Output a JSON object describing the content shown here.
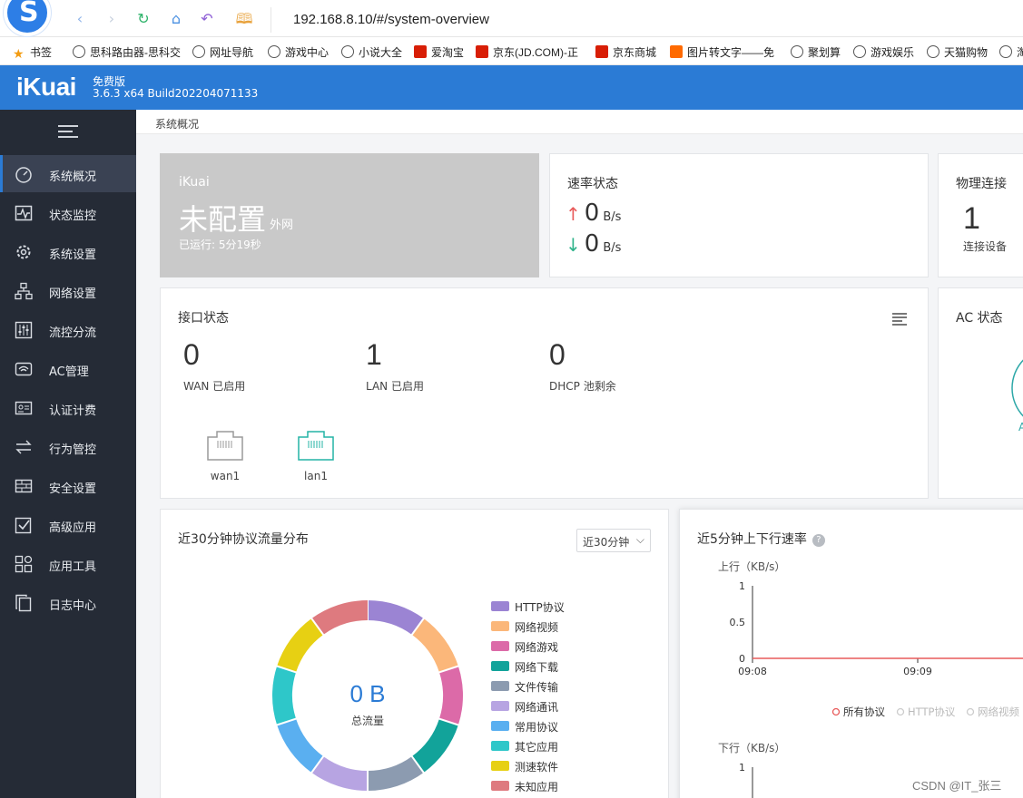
{
  "browser": {
    "url": "192.168.8.10/#/system-overview",
    "bookmarks": [
      {
        "label": "书签",
        "icon": "star-icon"
      },
      {
        "label": "思科路由器-思科交",
        "icon": "globe-icon"
      },
      {
        "label": "网址导航",
        "icon": "globe-icon"
      },
      {
        "label": "游戏中心",
        "icon": "globe-icon"
      },
      {
        "label": "小说大全",
        "icon": "globe-icon"
      },
      {
        "label": "爱淘宝",
        "icon": "taobao-icon"
      },
      {
        "label": "京东(JD.COM)-正",
        "icon": "jd-icon"
      },
      {
        "label": "京东商城",
        "icon": "jd-icon"
      },
      {
        "label": "图片转文字——免",
        "icon": "do-icon"
      },
      {
        "label": "聚划算",
        "icon": "globe-icon"
      },
      {
        "label": "游戏娱乐",
        "icon": "globe-icon"
      },
      {
        "label": "天猫购物",
        "icon": "globe-icon"
      },
      {
        "label": "淘",
        "icon": "globe-icon"
      }
    ]
  },
  "header": {
    "brand": "iKuai",
    "edition": "免费版",
    "version": "3.6.3 x64 Build202204071133",
    "brand_color": "#2b7bd5"
  },
  "sidebar": {
    "items": [
      {
        "label": "系统概况",
        "icon": "dashboard-gauge-icon",
        "active": true
      },
      {
        "label": "状态监控",
        "icon": "pulse-monitor-icon"
      },
      {
        "label": "系统设置",
        "icon": "gear-icon"
      },
      {
        "label": "网络设置",
        "icon": "network-topology-icon"
      },
      {
        "label": "流控分流",
        "icon": "sliders-icon"
      },
      {
        "label": "AC管理",
        "icon": "wifi-ap-icon"
      },
      {
        "label": "认证计费",
        "icon": "id-card-icon"
      },
      {
        "label": "行为管控",
        "icon": "swap-arrows-icon"
      },
      {
        "label": "安全设置",
        "icon": "firewall-icon"
      },
      {
        "label": "高级应用",
        "icon": "checked-box-icon"
      },
      {
        "label": "应用工具",
        "icon": "apps-grid-icon"
      },
      {
        "label": "日志中心",
        "icon": "document-copy-icon"
      }
    ]
  },
  "main": {
    "breadcrumb": "系统概况",
    "wan_card": {
      "brand": "iKuai",
      "status": "未配置",
      "sub": "外网",
      "uptime": "已运行: 5分19秒"
    },
    "rate_card": {
      "title": "速率状态",
      "up_value": "0",
      "up_unit": "B/s",
      "down_value": "0",
      "down_unit": "B/s"
    },
    "physical_card": {
      "title": "物理连接",
      "count": "1",
      "label": "连接设备"
    },
    "interface_card": {
      "title": "接口状态",
      "stats": [
        {
          "value": "0",
          "label": "WAN 已启用"
        },
        {
          "value": "1",
          "label": "LAN 已启用"
        },
        {
          "value": "0",
          "label": "DHCP 池剩余"
        }
      ],
      "ports": [
        {
          "name": "wan1",
          "connected": false
        },
        {
          "name": "lan1",
          "connected": true
        }
      ]
    },
    "ac_card": {
      "title": "AC 状态",
      "partial_text": "A"
    },
    "protocol_card": {
      "title": "近30分钟协议流量分布",
      "range": "近30分钟",
      "total_value": "0 B",
      "total_label": "总流量",
      "legend": [
        {
          "label": "HTTP协议",
          "color": "#9b84d3"
        },
        {
          "label": "网络视频",
          "color": "#fbb77a"
        },
        {
          "label": "网络游戏",
          "color": "#dc6aa8"
        },
        {
          "label": "网络下载",
          "color": "#12a39a"
        },
        {
          "label": "文件传输",
          "color": "#8c9bb0"
        },
        {
          "label": "网络通讯",
          "color": "#b7a4e2"
        },
        {
          "label": "常用协议",
          "color": "#5aaff0"
        },
        {
          "label": "其它应用",
          "color": "#2ec7c9"
        },
        {
          "label": "测速软件",
          "color": "#e7d013"
        },
        {
          "label": "未知应用",
          "color": "#de7a7f"
        }
      ]
    },
    "speed_card": {
      "title": "近5分钟上下行速率",
      "upload_axis": "上行（KB/s）",
      "download_axis": "下行（KB/s）",
      "upload_ticks": [
        "1",
        "0.5",
        "0"
      ],
      "download_ticks": [
        "1"
      ],
      "x_ticks": [
        "09:08",
        "09:09"
      ],
      "legend": [
        "所有协议",
        "HTTP协议",
        "网络视频"
      ],
      "line_color": "#e85b5b"
    }
  },
  "chart_data": {
    "type": "line",
    "title": "近5分钟上下行速率",
    "ylabel": "上行（KB/s）",
    "x": [
      "09:08",
      "09:09"
    ],
    "ylim": [
      0,
      1
    ],
    "series": [
      {
        "name": "所有协议",
        "values": [
          0,
          0
        ]
      }
    ]
  },
  "watermark": "CSDN @IT_张三"
}
